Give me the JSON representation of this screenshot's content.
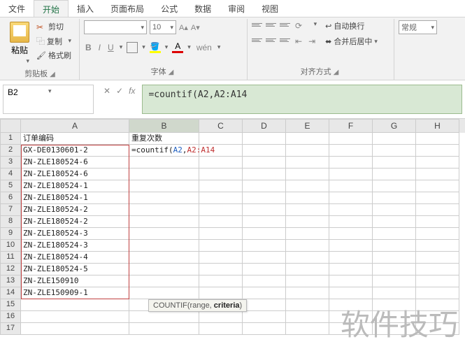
{
  "tabs": {
    "file": "文件",
    "home": "开始",
    "insert": "插入",
    "layout": "页面布局",
    "formulas": "公式",
    "data": "数据",
    "review": "审阅",
    "view": "视图"
  },
  "clipboard": {
    "paste": "粘贴",
    "cut": "剪切",
    "copy": "复制",
    "format_painter": "格式刷",
    "title": "剪贴板"
  },
  "font": {
    "size": "10",
    "inc": "A▴",
    "dec": "A▾",
    "bold": "B",
    "italic": "I",
    "underline": "U",
    "color": "A",
    "title": "字体"
  },
  "align": {
    "wrap": "自动换行",
    "merge": "合并后居中",
    "title": "对齐方式"
  },
  "number": {
    "general": "常规"
  },
  "namebox": "B2",
  "formula_bar": "=countif(A2,A2:A14",
  "formula_parts": {
    "prefix": "=countif(",
    "ref1": "A2",
    "comma": ",",
    "ref2": "A2:A14"
  },
  "tooltip": {
    "fn": "COUNTIF(",
    "p1": "range, ",
    "p2": "criteria",
    "suffix": ")"
  },
  "columns": [
    "A",
    "B",
    "C",
    "D",
    "E",
    "F",
    "G",
    "H"
  ],
  "chart_data": {
    "type": "table",
    "headers": {
      "A": "订单编码",
      "B": "重复次数"
    },
    "rows": [
      {
        "n": 1,
        "A": "订单编码",
        "B": "重复次数"
      },
      {
        "n": 2,
        "A": "GX-DE0130601-2",
        "B": "__FORMULA__"
      },
      {
        "n": 3,
        "A": "ZN-ZLE180524-6",
        "B": ""
      },
      {
        "n": 4,
        "A": "ZN-ZLE180524-6",
        "B": ""
      },
      {
        "n": 5,
        "A": "ZN-ZLE180524-1",
        "B": ""
      },
      {
        "n": 6,
        "A": "ZN-ZLE180524-1",
        "B": ""
      },
      {
        "n": 7,
        "A": "ZN-ZLE180524-2",
        "B": ""
      },
      {
        "n": 8,
        "A": "ZN-ZLE180524-2",
        "B": ""
      },
      {
        "n": 9,
        "A": "ZN-ZLE180524-3",
        "B": ""
      },
      {
        "n": 10,
        "A": "ZN-ZLE180524-3",
        "B": ""
      },
      {
        "n": 11,
        "A": "ZN-ZLE180524-4",
        "B": ""
      },
      {
        "n": 12,
        "A": "ZN-ZLE180524-5",
        "B": ""
      },
      {
        "n": 13,
        "A": "ZN-ZLE150910",
        "B": ""
      },
      {
        "n": 14,
        "A": "ZN-ZLE150909-1",
        "B": ""
      },
      {
        "n": 15,
        "A": "",
        "B": ""
      },
      {
        "n": 16,
        "A": "",
        "B": ""
      },
      {
        "n": 17,
        "A": "",
        "B": ""
      }
    ]
  },
  "watermark": "软件技巧"
}
